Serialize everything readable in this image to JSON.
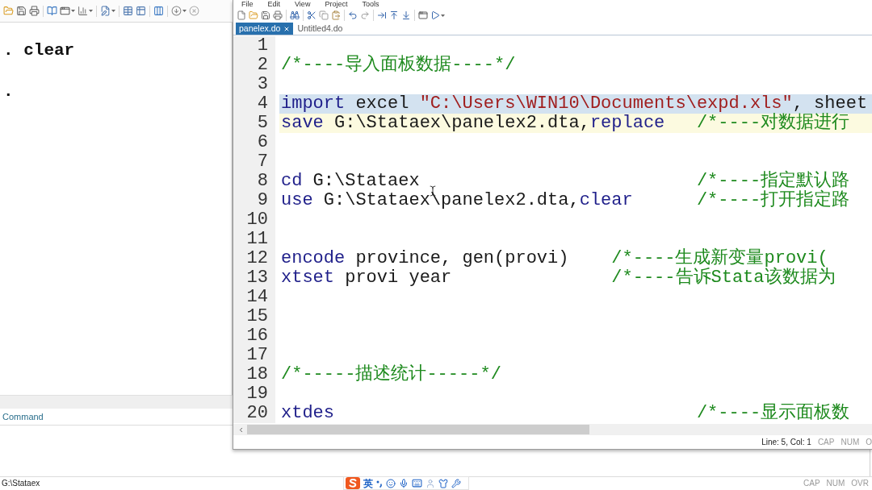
{
  "main_window": {
    "results": [
      ". clear",
      "."
    ],
    "command_label": "Command",
    "status_path": "G:\\Stataex",
    "indicators": [
      {
        "label": "CAP",
        "on": false
      },
      {
        "label": "NUM",
        "on": false
      },
      {
        "label": "OVR",
        "on": false
      }
    ]
  },
  "editor": {
    "menu": [
      "File",
      "Edit",
      "View",
      "Project",
      "Tools"
    ],
    "tabs": [
      {
        "label": "panelex.do",
        "selected": true
      },
      {
        "label": "Untitled4.do",
        "selected": false
      }
    ],
    "lines": [
      {
        "number": "1",
        "selected": false,
        "current": false
      },
      {
        "number": "2",
        "selected": false,
        "current": false,
        "comment": "/*----导入面板数据----*/"
      },
      {
        "number": "3",
        "selected": false,
        "current": false
      },
      {
        "number": "4",
        "selected": true,
        "current": false,
        "code": [
          {
            "kind": "keyword",
            "text": "import"
          },
          {
            "kind": "plain",
            "text": " excel "
          },
          {
            "kind": "string",
            "text": "\"C:\\Users\\WIN10\\Documents\\expd.xls\""
          },
          {
            "kind": "plain",
            "text": ", sheet"
          }
        ]
      },
      {
        "number": "5",
        "selected": false,
        "current": true,
        "code": [
          {
            "kind": "keyword",
            "text": "save"
          },
          {
            "kind": "plain",
            "text": " G:\\Stataex\\panelex2.dta,"
          },
          {
            "kind": "keyword",
            "text": "replace   "
          }
        ],
        "comment": "/*----对数据进行"
      },
      {
        "number": "6",
        "selected": false,
        "current": false
      },
      {
        "number": "7",
        "selected": false,
        "current": false
      },
      {
        "number": "8",
        "selected": false,
        "current": false,
        "code": [
          {
            "kind": "keyword",
            "text": "cd"
          },
          {
            "kind": "plain",
            "text": " G:\\Stataex                          "
          }
        ],
        "comment": "/*----指定默认路"
      },
      {
        "number": "9",
        "selected": false,
        "current": false,
        "code": [
          {
            "kind": "keyword",
            "text": "use"
          },
          {
            "kind": "plain",
            "text": " G:\\Stataex\\panelex2.dta,"
          },
          {
            "kind": "keyword",
            "text": "clear      "
          }
        ],
        "comment": "/*----打开指定路"
      },
      {
        "number": "10",
        "selected": false,
        "current": false
      },
      {
        "number": "11",
        "selected": false,
        "current": false
      },
      {
        "number": "12",
        "selected": false,
        "current": false,
        "code": [
          {
            "kind": "keyword",
            "text": "encode"
          },
          {
            "kind": "plain",
            "text": " province, gen(provi)    "
          }
        ],
        "comment": "/*----生成新变量provi("
      },
      {
        "number": "13",
        "selected": false,
        "current": false,
        "code": [
          {
            "kind": "keyword",
            "text": "xtset"
          },
          {
            "kind": "plain",
            "text": " provi year               "
          }
        ],
        "comment": "/*----告诉Stata该数据为"
      },
      {
        "number": "14",
        "selected": false,
        "current": false
      },
      {
        "number": "15",
        "selected": false,
        "current": false
      },
      {
        "number": "16",
        "selected": false,
        "current": false
      },
      {
        "number": "17",
        "selected": false,
        "current": false
      },
      {
        "number": "18",
        "selected": false,
        "current": false,
        "comment": "/*-----描述统计-----*/"
      },
      {
        "number": "19",
        "selected": false,
        "current": false
      },
      {
        "number": "20",
        "selected": false,
        "current": false,
        "code": [
          {
            "kind": "keyword",
            "text": "xtdes                                  "
          }
        ],
        "comment": "/*----显示面板数"
      }
    ],
    "status": {
      "position": "Line: 5, Col: 1",
      "indicators": [
        {
          "label": "CAP",
          "on": false
        },
        {
          "label": "NUM",
          "on": false
        },
        {
          "label": "O",
          "on": false
        }
      ]
    }
  },
  "ime_bar": {
    "mode": "英"
  }
}
